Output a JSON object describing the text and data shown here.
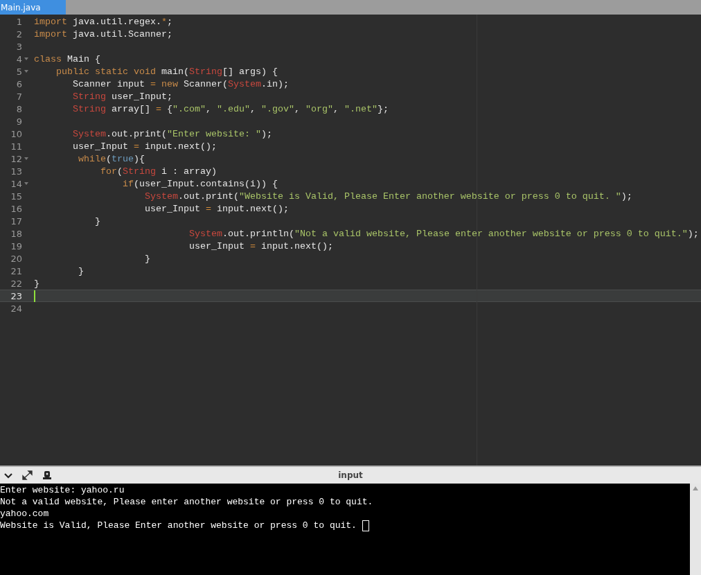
{
  "tabs": [
    {
      "label": "Main.java",
      "selected": true
    }
  ],
  "editor": {
    "lines": [
      {
        "number": "1",
        "fold": false,
        "current": false,
        "tokens": [
          {
            "kind": "keyword",
            "text": "import"
          },
          {
            "kind": "plain",
            "text": " java.util.regex."
          },
          {
            "kind": "operator",
            "text": "*"
          },
          {
            "kind": "plain",
            "text": ";"
          }
        ]
      },
      {
        "number": "2",
        "fold": false,
        "current": false,
        "tokens": [
          {
            "kind": "keyword",
            "text": "import"
          },
          {
            "kind": "plain",
            "text": " java.util.Scanner;"
          }
        ]
      },
      {
        "number": "3",
        "fold": false,
        "current": false
      },
      {
        "number": "4",
        "fold": true,
        "current": false,
        "tokens": [
          {
            "kind": "keyword",
            "text": "class"
          },
          {
            "kind": "plain",
            "text": " Main {"
          }
        ]
      },
      {
        "number": "5",
        "fold": true,
        "current": false,
        "tokens": [
          {
            "kind": "keyword",
            "text": "    public static void"
          },
          {
            "kind": "plain",
            "text": " main("
          },
          {
            "kind": "type",
            "text": "String"
          },
          {
            "kind": "plain",
            "text": "[] args) {"
          }
        ]
      },
      {
        "number": "6",
        "fold": false,
        "current": false,
        "tokens": [
          {
            "kind": "plain",
            "text": "       Scanner input "
          },
          {
            "kind": "operator",
            "text": "="
          },
          {
            "kind": "keyword",
            "text": " new"
          },
          {
            "kind": "plain",
            "text": " Scanner("
          },
          {
            "kind": "type",
            "text": "System"
          },
          {
            "kind": "plain",
            "text": ".in);"
          }
        ]
      },
      {
        "number": "7",
        "fold": false,
        "current": false,
        "tokens": [
          {
            "kind": "type",
            "text": "       String"
          },
          {
            "kind": "plain",
            "text": " user_Input;"
          }
        ]
      },
      {
        "number": "8",
        "fold": false,
        "current": false,
        "tokens": [
          {
            "kind": "type",
            "text": "       String"
          },
          {
            "kind": "plain",
            "text": " array[] "
          },
          {
            "kind": "operator",
            "text": "="
          },
          {
            "kind": "plain",
            "text": " {"
          },
          {
            "kind": "string",
            "text": "\".com\""
          },
          {
            "kind": "plain",
            "text": ", "
          },
          {
            "kind": "string",
            "text": "\".edu\""
          },
          {
            "kind": "plain",
            "text": ", "
          },
          {
            "kind": "string",
            "text": "\".gov\""
          },
          {
            "kind": "plain",
            "text": ", "
          },
          {
            "kind": "string",
            "text": "\"org\""
          },
          {
            "kind": "plain",
            "text": ", "
          },
          {
            "kind": "string",
            "text": "\".net\""
          },
          {
            "kind": "plain",
            "text": "};"
          }
        ]
      },
      {
        "number": "9",
        "fold": false,
        "current": false
      },
      {
        "number": "10",
        "fold": false,
        "current": false,
        "tokens": [
          {
            "kind": "type",
            "text": "       System"
          },
          {
            "kind": "plain",
            "text": ".out.print("
          },
          {
            "kind": "string",
            "text": "\"Enter website: \""
          },
          {
            "kind": "plain",
            "text": ");"
          }
        ]
      },
      {
        "number": "11",
        "fold": false,
        "current": false,
        "tokens": [
          {
            "kind": "plain",
            "text": "       user_Input "
          },
          {
            "kind": "operator",
            "text": "="
          },
          {
            "kind": "plain",
            "text": " input.next();"
          }
        ]
      },
      {
        "number": "12",
        "fold": true,
        "current": false,
        "tokens": [
          {
            "kind": "keyword",
            "text": "        while"
          },
          {
            "kind": "plain",
            "text": "("
          },
          {
            "kind": "constant",
            "text": "true"
          },
          {
            "kind": "plain",
            "text": "){"
          }
        ]
      },
      {
        "number": "13",
        "fold": false,
        "current": false,
        "tokens": [
          {
            "kind": "keyword",
            "text": "            for"
          },
          {
            "kind": "plain",
            "text": "("
          },
          {
            "kind": "type",
            "text": "String"
          },
          {
            "kind": "plain",
            "text": " i : array)"
          }
        ]
      },
      {
        "number": "14",
        "fold": true,
        "current": false,
        "tokens": [
          {
            "kind": "keyword",
            "text": "                if"
          },
          {
            "kind": "plain",
            "text": "(user_Input.contains(i)) {"
          }
        ]
      },
      {
        "number": "15",
        "fold": false,
        "current": false,
        "tokens": [
          {
            "kind": "type",
            "text": "                    System"
          },
          {
            "kind": "plain",
            "text": ".out.print("
          },
          {
            "kind": "string",
            "text": "\"Website is Valid, Please Enter another website or press 0 to quit. \""
          },
          {
            "kind": "plain",
            "text": ");"
          }
        ]
      },
      {
        "number": "16",
        "fold": false,
        "current": false,
        "tokens": [
          {
            "kind": "plain",
            "text": "                    user_Input "
          },
          {
            "kind": "operator",
            "text": "="
          },
          {
            "kind": "plain",
            "text": " input.next();"
          }
        ]
      },
      {
        "number": "17",
        "fold": false,
        "current": false,
        "tokens": [
          {
            "kind": "plain",
            "text": "           }"
          }
        ]
      },
      {
        "number": "18",
        "fold": false,
        "current": false,
        "tokens": [
          {
            "kind": "type",
            "text": "                            System"
          },
          {
            "kind": "plain",
            "text": ".out.println("
          },
          {
            "kind": "string",
            "text": "\"Not a valid website, Please enter another website or press 0 to quit.\""
          },
          {
            "kind": "plain",
            "text": ");"
          }
        ]
      },
      {
        "number": "19",
        "fold": false,
        "current": false,
        "tokens": [
          {
            "kind": "plain",
            "text": "                            user_Input "
          },
          {
            "kind": "operator",
            "text": "="
          },
          {
            "kind": "plain",
            "text": " input.next();"
          }
        ]
      },
      {
        "number": "20",
        "fold": false,
        "current": false,
        "tokens": [
          {
            "kind": "plain",
            "text": "                    }"
          }
        ]
      },
      {
        "number": "21",
        "fold": false,
        "current": false,
        "tokens": [
          {
            "kind": "plain",
            "text": "        }"
          }
        ]
      },
      {
        "number": "22",
        "fold": false,
        "current": false,
        "tokens": [
          {
            "kind": "plain",
            "text": "}"
          }
        ]
      },
      {
        "number": "23",
        "fold": false,
        "current": true
      },
      {
        "number": "24",
        "fold": false,
        "current": false
      }
    ]
  },
  "console": {
    "title": "input",
    "cursor": true,
    "lines": [
      "Enter website: yahoo.ru",
      "Not a valid website, Please enter another website or press 0 to quit.",
      "yahoo.com",
      "Website is Valid, Please Enter another website or press 0 to quit. "
    ]
  }
}
